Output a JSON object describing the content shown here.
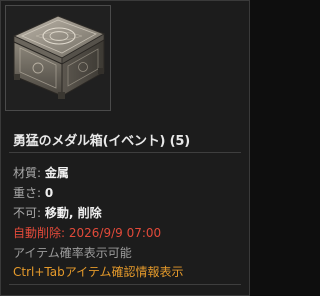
{
  "item": {
    "name": "勇猛のメダル箱(イベント) (5)",
    "icon": "ornate-chest-icon"
  },
  "props": {
    "material_label": "材質:",
    "material_value": "金属",
    "weight_label": "重さ:",
    "weight_value": "0",
    "restrict_label": "不可:",
    "restrict_value": "移動, 削除",
    "auto_delete": "自動削除: 2026/9/9 07:00",
    "probability": "アイテム確率表示可能",
    "hint": "Ctrl+Tabアイテム確認情報表示"
  },
  "colors": {
    "frame": "#3a3a3a",
    "background": "#1c1c1c",
    "label": "#a9a9a9",
    "value": "#f0f0f0",
    "warning": "#e24a3a",
    "hint": "#e59a2b"
  }
}
